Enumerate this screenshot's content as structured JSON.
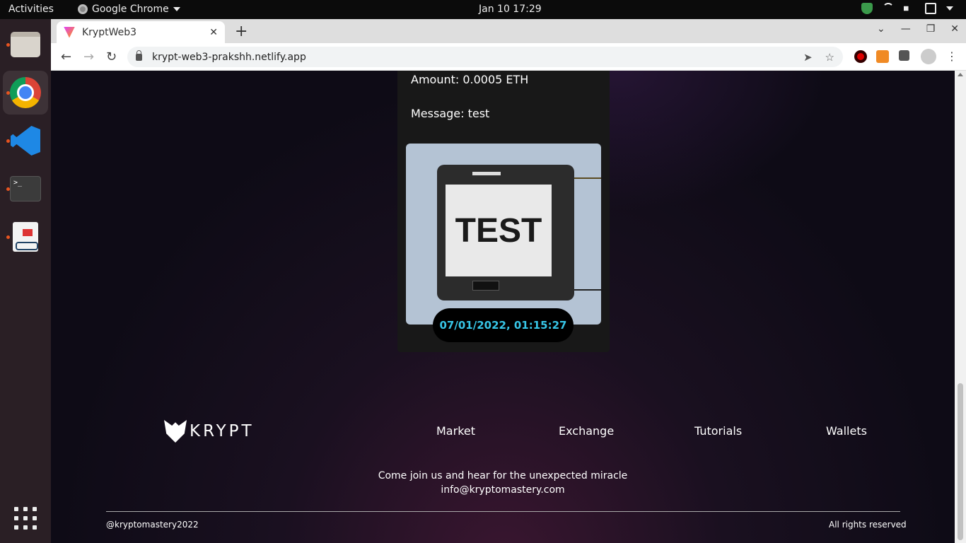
{
  "topbar": {
    "activities": "Activities",
    "app_name": "Google Chrome",
    "clock": "Jan 10  17:29"
  },
  "browser": {
    "tab_title": "KryptWeb3",
    "url": "krypt-web3-prakshh.netlify.app"
  },
  "transaction": {
    "amount": "Amount: 0.0005 ETH",
    "message": "Message: test",
    "image_text": "TEST",
    "timestamp": "07/01/2022, 01:15:27"
  },
  "footer": {
    "logo_text": "KRYPT",
    "links": [
      "Market",
      "Exchange",
      "Tutorials",
      "Wallets"
    ],
    "tagline": "Come join us and hear for the unexpected miracle",
    "email": "info@kryptomastery.com",
    "handle": "@kryptomastery2022",
    "rights": "All rights reserved"
  },
  "colors": {
    "accent_timestamp": "#37c6e7",
    "page_bg": "#0e0b16",
    "card_bg": "#181818"
  }
}
